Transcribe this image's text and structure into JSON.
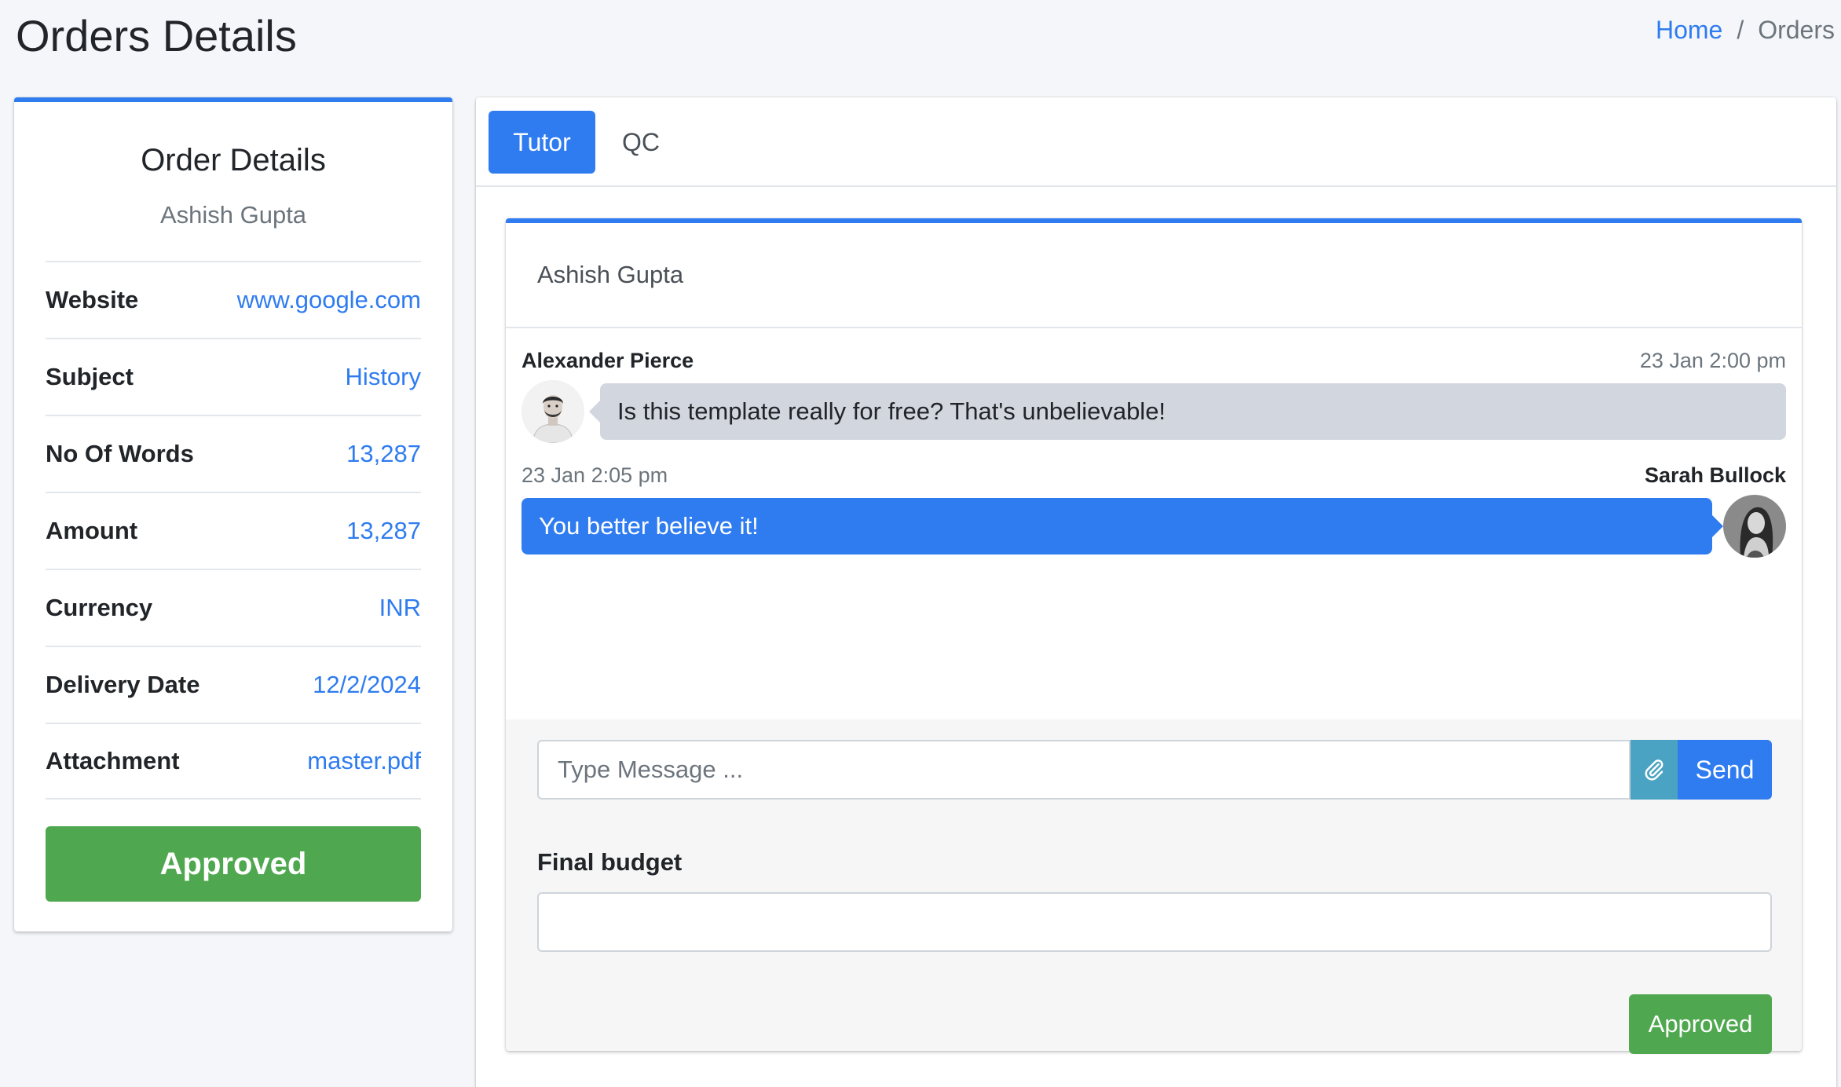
{
  "header": {
    "title": "Orders Details",
    "breadcrumb": {
      "home": "Home",
      "separator": "/",
      "current": "Orders"
    }
  },
  "profile": {
    "title": "Order Details",
    "subtitle": "Ashish Gupta",
    "details": [
      {
        "label": "Website",
        "value": "www.google.com"
      },
      {
        "label": "Subject",
        "value": "History"
      },
      {
        "label": "No Of Words",
        "value": "13,287"
      },
      {
        "label": "Amount",
        "value": "13,287"
      },
      {
        "label": "Currency",
        "value": "INR"
      },
      {
        "label": "Delivery Date",
        "value": "12/2/2024"
      },
      {
        "label": "Attachment",
        "value": "master.pdf"
      }
    ],
    "status_button": "Approved"
  },
  "tabs": [
    {
      "label": "Tutor",
      "active": true
    },
    {
      "label": "QC",
      "active": false
    }
  ],
  "chat": {
    "title": "Ashish Gupta",
    "messages": [
      {
        "name": "Alexander Pierce",
        "time": "23 Jan 2:00 pm",
        "text": "Is this template really for free? That's unbelievable!",
        "side": "left"
      },
      {
        "name": "Sarah Bullock",
        "time": "23 Jan 2:05 pm",
        "text": "You better believe it!",
        "side": "right"
      }
    ],
    "input_placeholder": "Type Message ...",
    "send_label": "Send",
    "budget_label": "Final budget",
    "budget_value": "",
    "approve_label": "Approved"
  },
  "colors": {
    "primary": "#2f7cf0",
    "success": "#4fa84f",
    "info": "#4aa3c2",
    "bubble_left": "#d2d6de"
  },
  "icons": {
    "attach": "paperclip-icon"
  }
}
